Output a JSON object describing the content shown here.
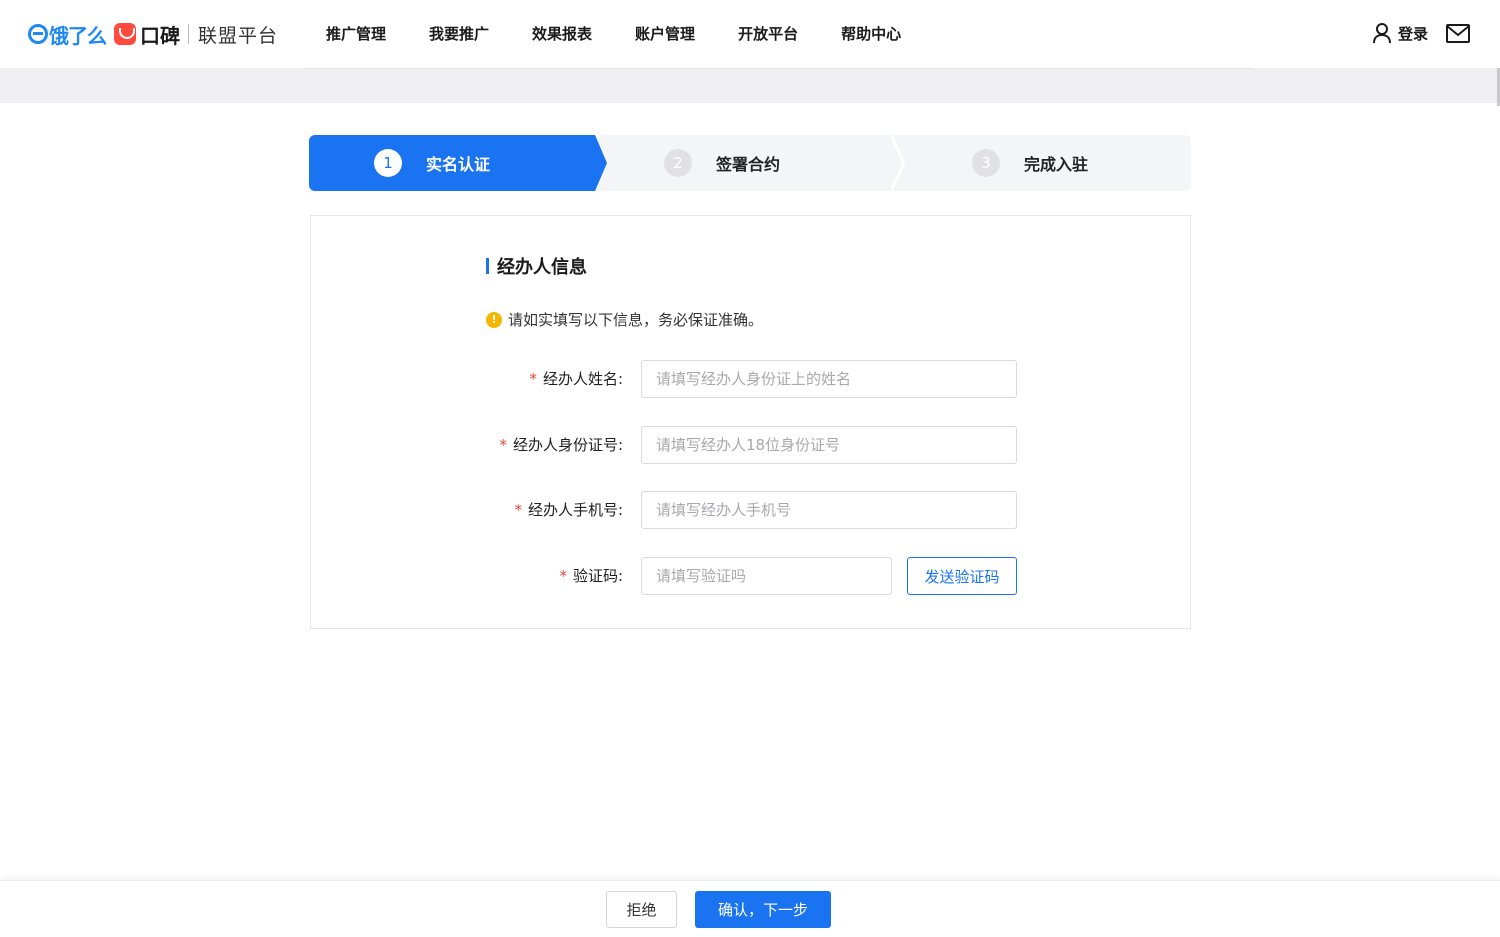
{
  "header": {
    "logo": {
      "eleme": "饿了么",
      "koubei": "口碑",
      "platform": "联盟平台"
    },
    "nav": [
      "推广管理",
      "我要推广",
      "效果报表",
      "账户管理",
      "开放平台",
      "帮助中心"
    ],
    "login_label": "登录",
    "icons": {
      "user": "user-icon",
      "mail": "mail-icon"
    }
  },
  "steps": [
    {
      "num": "1",
      "label": "实名认证",
      "state": "active"
    },
    {
      "num": "2",
      "label": "签署合约",
      "state": "inactive"
    },
    {
      "num": "3",
      "label": "完成入驻",
      "state": "inactive"
    }
  ],
  "form": {
    "title": "经办人信息",
    "notice": "请如实填写以下信息，务必保证准确。",
    "fields": [
      {
        "label": "经办人姓名:",
        "placeholder": "请填写经办人身份证上的姓名",
        "value": ""
      },
      {
        "label": "经办人身份证号:",
        "placeholder": "请填写经办人18位身份证号",
        "value": ""
      },
      {
        "label": "经办人手机号:",
        "placeholder": "请填写经办人手机号",
        "value": ""
      },
      {
        "label": "验证码:",
        "placeholder": "请填写验证吗",
        "value": ""
      }
    ],
    "required_mark": "*",
    "send_code_label": "发送验证码"
  },
  "footer": {
    "reject_label": "拒绝",
    "next_label": "确认，下一步"
  },
  "colors": {
    "accent": "#1a73f0",
    "required": "#f0433a",
    "notice": "#f7b500"
  }
}
